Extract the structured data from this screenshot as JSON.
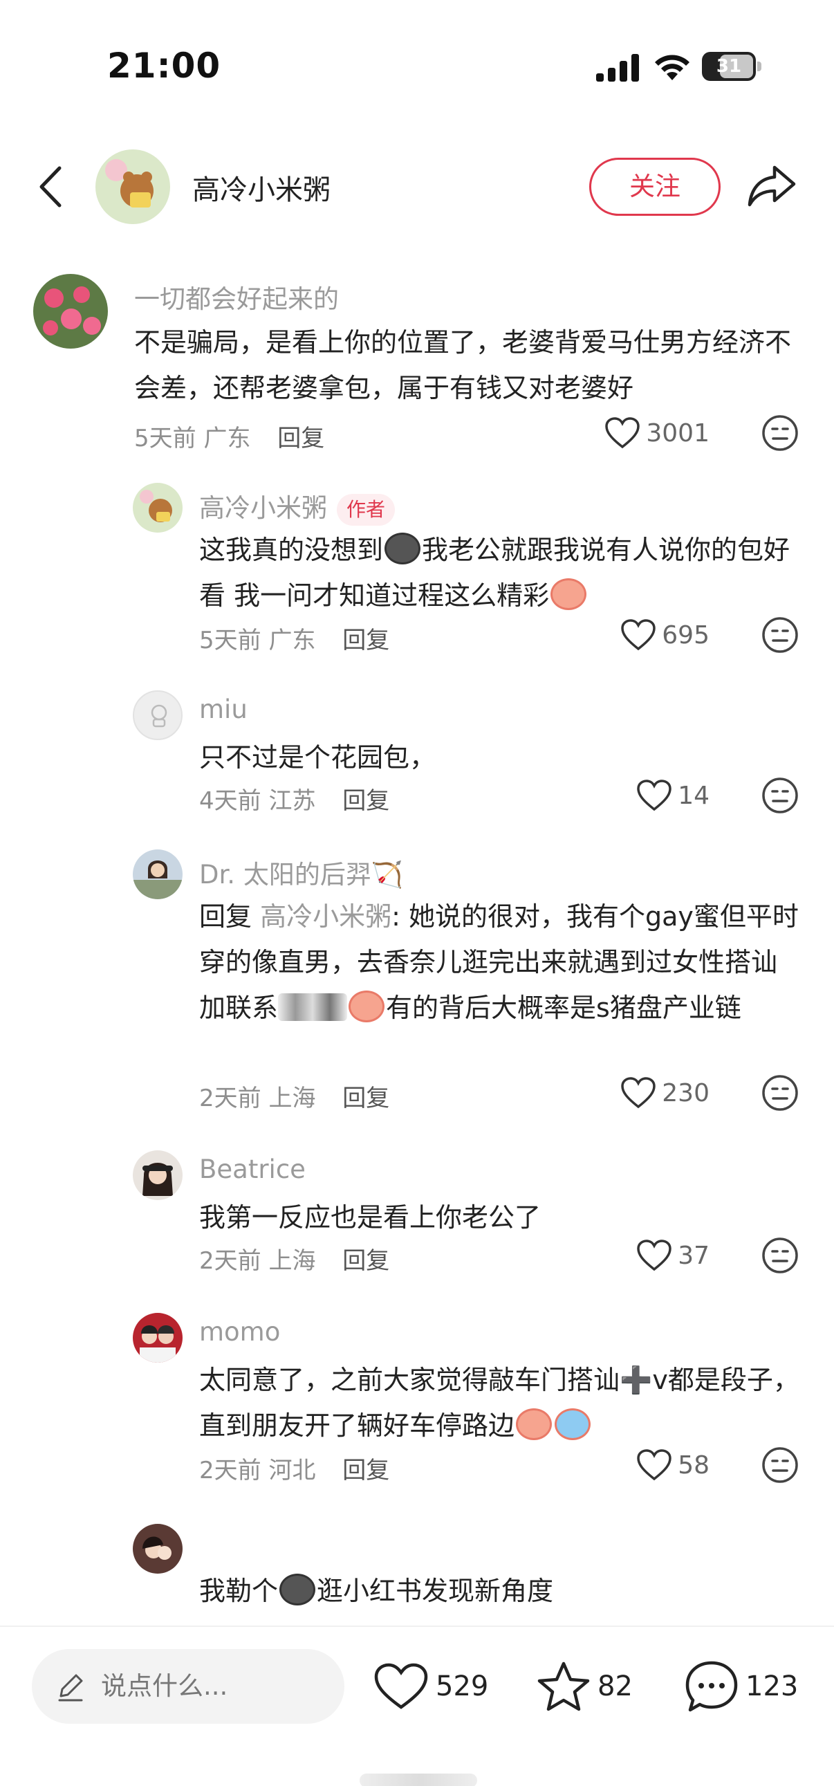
{
  "status_bar": {
    "time": "21:00",
    "battery": "31"
  },
  "header": {
    "name": "高冷小米粥",
    "follow_label": "关注"
  },
  "comments": [
    {
      "username": "一切都会好起来的",
      "content": "不是骗局，是看上你的位置了，老婆背爱马仕男方经济不会差，还帮老婆拿包，属于有钱又对老婆好",
      "time": "5天前",
      "location": "广东",
      "reply_label": "回复",
      "likes": "3001"
    },
    {
      "username": "高冷小米粥",
      "badge": "作者",
      "content_a": "这我真的没想到",
      "content_b": "我老公就跟我说有人说你的包好看 我一问才知道过程这么精彩",
      "time": "5天前",
      "location": "广东",
      "reply_label": "回复",
      "likes": "695"
    },
    {
      "username": "miu",
      "content": "只不过是个花园包，",
      "time": "4天前",
      "location": "江苏",
      "reply_label": "回复",
      "likes": "14"
    },
    {
      "username": "Dr. 太阳的后羿🏹",
      "reply_prefix": "回复 ",
      "reply_to": "高冷小米粥",
      "content_a": ": 她说的很对，我有个gay蜜但平时穿的像直男，去香奈儿逛完出来就遇到过女性搭讪加联系",
      "content_b": "有的背后大概率是s猪盘产业链",
      "time": "2天前",
      "location": "上海",
      "reply_label": "回复",
      "likes": "230"
    },
    {
      "username": "Beatrice",
      "content": "我第一反应也是看上你老公了",
      "time": "2天前",
      "location": "上海",
      "reply_label": "回复",
      "likes": "37"
    },
    {
      "username": "momo",
      "content_a": "太同意了，之前大家觉得敲车门搭讪",
      "plus": "➕",
      "content_b": "v都是段子，直到朋友开了辆好车停路边",
      "time": "2天前",
      "location": "河北",
      "reply_label": "回复",
      "likes": "58"
    },
    {
      "username": "",
      "content_a": "我勒个",
      "content_b": "逛小红书发现新角度"
    }
  ],
  "bottom_bar": {
    "input_placeholder": "说点什么...",
    "likes": "529",
    "favorites": "82",
    "comments": "123"
  },
  "colors": {
    "accent": "#e0384d",
    "secondary_text": "#9a9a9a"
  }
}
